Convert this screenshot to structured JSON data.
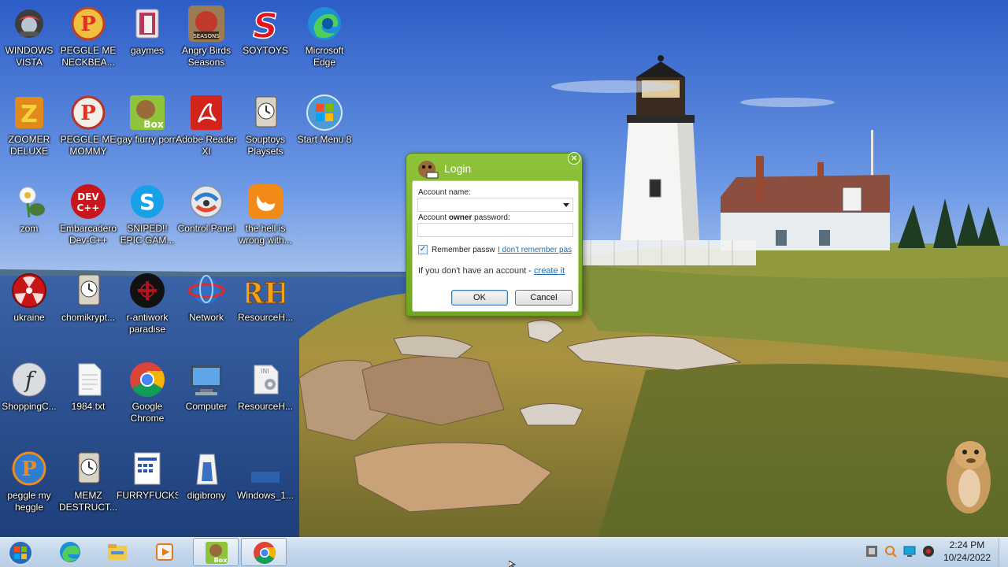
{
  "desktop_icons": [
    {
      "label": "WINDOWS VISTA",
      "icon": "vista-orb-icon"
    },
    {
      "label": "PEGGLE ME NECKBEA...",
      "icon": "peggle-icon"
    },
    {
      "label": "gaymes",
      "icon": "folder-icon"
    },
    {
      "label": "Angry Birds Seasons",
      "icon": "angry-birds-icon"
    },
    {
      "label": "SOYTOYS",
      "icon": "soytoys-icon"
    },
    {
      "label": "Microsoft Edge",
      "icon": "edge-icon"
    },
    {
      "label": "ZOOMER DELUXE",
      "icon": "zoomer-icon"
    },
    {
      "label": "PEGGLE ME MOMMY",
      "icon": "peggle-icon"
    },
    {
      "label": "gay fiurry porn",
      "icon": "bonzi-box-icon"
    },
    {
      "label": "Adobe Reader XI",
      "icon": "adobe-reader-icon"
    },
    {
      "label": "Souptoys Playsets",
      "icon": "installer-icon"
    },
    {
      "label": "Start Menu 8",
      "icon": "start-orb-icon"
    },
    {
      "label": "zom",
      "icon": "zombie-flower-icon"
    },
    {
      "label": "Embarcadero Dev-C++",
      "icon": "devcpp-icon"
    },
    {
      "label": "SNIPED!! EPIC GAM...",
      "icon": "skype-icon"
    },
    {
      "label": "Control Panel",
      "icon": "control-panel-icon"
    },
    {
      "label": "the hell is wrong with...",
      "icon": "uc-browser-icon"
    },
    {
      "label": "ukraine",
      "icon": "radiation-icon"
    },
    {
      "label": "chomikrypt...",
      "icon": "installer-icon"
    },
    {
      "label": "r-antiwork paradise",
      "icon": "antiwork-icon"
    },
    {
      "label": "Network",
      "icon": "network-icon"
    },
    {
      "label": "ResourceH...",
      "icon": "resource-hacker-icon"
    },
    {
      "label": "ShoppingC...",
      "icon": "flash-icon"
    },
    {
      "label": "1984.txt",
      "icon": "text-file-icon"
    },
    {
      "label": "Google Chrome",
      "icon": "chrome-icon"
    },
    {
      "label": "Computer",
      "icon": "computer-icon"
    },
    {
      "label": "ResourceH...",
      "icon": "ini-file-icon"
    },
    {
      "label": "peggle my heggle",
      "icon": "peggle-icon"
    },
    {
      "label": "MEMZ DESTRUCT...",
      "icon": "installer-icon"
    },
    {
      "label": "FURRYFUCKS",
      "icon": "calendar-file-icon"
    },
    {
      "label": "digibrony",
      "icon": "digibrony-icon"
    },
    {
      "label": "Windows_1...",
      "icon": "windows-file-icon"
    }
  ],
  "login_dialog": {
    "title": "Login",
    "account_name_label": "Account name:",
    "account_name_value": "",
    "password_label_prefix": "Account ",
    "password_label_bold": "owner",
    "password_label_suffix": " password:",
    "password_value": "",
    "remember_label": "Remember passw",
    "remember_checked": true,
    "forgot_link": "I don't remember pas",
    "no_account_text": "If you don't have an account - ",
    "create_link": "create it",
    "ok_label": "OK",
    "cancel_label": "Cancel",
    "close_glyph": "×"
  },
  "taskbar": {
    "pinned": [
      "edge-icon",
      "file-explorer-icon",
      "media-player-icon",
      "bonzi-box-icon",
      "chrome-icon"
    ],
    "clock_time": "2:24 PM",
    "clock_date": "10/24/2022"
  }
}
